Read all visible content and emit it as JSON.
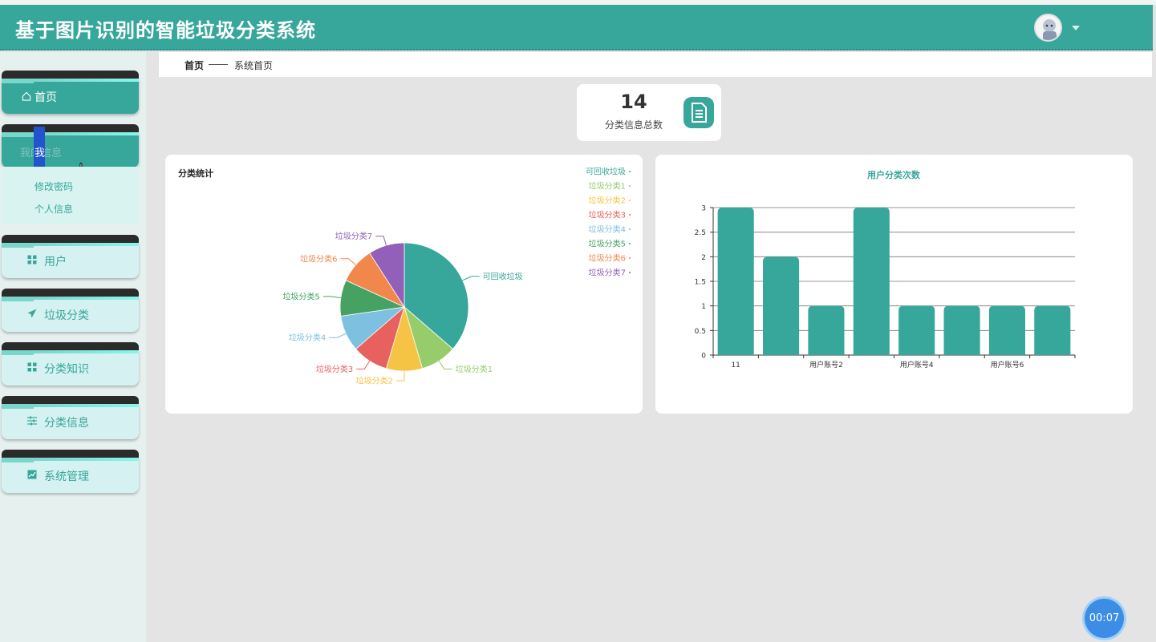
{
  "app": {
    "title": "基于图片识别的智能垃圾分类系统"
  },
  "sidebar": {
    "items": [
      {
        "label": "首页",
        "icon": "home-icon"
      },
      {
        "label": "我的信息",
        "icon": "grid-icon"
      },
      {
        "label": "用户",
        "icon": "grid-icon"
      },
      {
        "label": "垃圾分类",
        "icon": "send-icon"
      },
      {
        "label": "分类知识",
        "icon": "grid-icon"
      },
      {
        "label": "分类信息",
        "icon": "sliders-icon"
      },
      {
        "label": "系统管理",
        "icon": "chart-icon"
      }
    ],
    "submenu": [
      {
        "label": "修改密码"
      },
      {
        "label": "个人信息"
      }
    ],
    "cursor_char": "我"
  },
  "breadcrumb": {
    "home": "首页",
    "current": "系统首页"
  },
  "stat": {
    "value": "14",
    "label": "分类信息总数"
  },
  "pie_card": {
    "title": "分类统计"
  },
  "bar_card": {
    "title": "用户分类次数"
  },
  "timer": "00:07",
  "colors": {
    "accent": "#37a79b"
  },
  "chart_data": [
    {
      "type": "pie",
      "title": "分类统计",
      "legend": "top-right",
      "slices": [
        {
          "name": "可回收垃圾",
          "value": 4,
          "color": "#37a79b"
        },
        {
          "name": "垃圾分类1",
          "value": 1,
          "color": "#96cc6a"
        },
        {
          "name": "垃圾分类2",
          "value": 1,
          "color": "#f5c445"
        },
        {
          "name": "垃圾分类3",
          "value": 1,
          "color": "#e7625f"
        },
        {
          "name": "垃圾分类4",
          "value": 1,
          "color": "#7ec0e0"
        },
        {
          "name": "垃圾分类5",
          "value": 1,
          "color": "#46a263"
        },
        {
          "name": "垃圾分类6",
          "value": 1,
          "color": "#f2874c"
        },
        {
          "name": "垃圾分类7",
          "value": 1,
          "color": "#9260b8"
        }
      ]
    },
    {
      "type": "bar",
      "title": "用户分类次数",
      "categories": [
        "11",
        "",
        "用户账号2",
        "",
        "用户账号4",
        "",
        "用户账号6",
        ""
      ],
      "values": [
        3,
        2,
        1,
        3,
        1,
        1,
        1,
        1
      ],
      "ylim": [
        0,
        3
      ],
      "yticks": [
        "0",
        "0.5",
        "1",
        "1.5",
        "2",
        "2.5",
        "3"
      ],
      "grid": true,
      "color": "#37a79b"
    }
  ]
}
